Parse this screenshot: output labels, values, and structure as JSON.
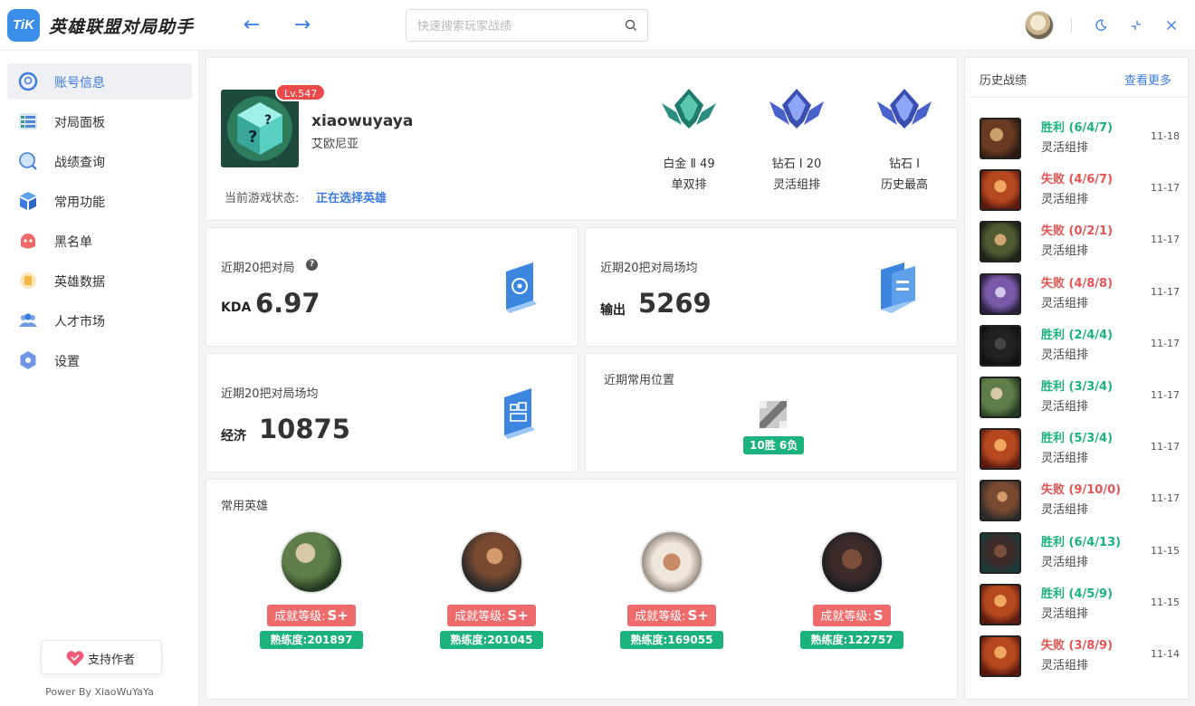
{
  "app": {
    "logo_text": "TiK",
    "title": "英雄联盟对局助手"
  },
  "header": {
    "search_placeholder": "快速搜索玩家战绩",
    "icons": [
      "back-arrow-icon",
      "forward-arrow-icon",
      "search-icon",
      "moon-icon",
      "minimize-icon",
      "close-icon"
    ]
  },
  "sidebar": {
    "items": [
      {
        "label": "账号信息",
        "icon": "account-icon",
        "active": true
      },
      {
        "label": "对局面板",
        "icon": "match-panel-icon",
        "active": false
      },
      {
        "label": "战绩查询",
        "icon": "record-search-icon",
        "active": false
      },
      {
        "label": "常用功能",
        "icon": "tools-icon",
        "active": false
      },
      {
        "label": "黑名单",
        "icon": "blacklist-icon",
        "active": false
      },
      {
        "label": "英雄数据",
        "icon": "champion-data-icon",
        "active": false
      },
      {
        "label": "人才市场",
        "icon": "talent-market-icon",
        "active": false
      },
      {
        "label": "设置",
        "icon": "settings-icon",
        "active": false
      }
    ],
    "support_label": "支持作者",
    "powered_by": "Power By XiaoWuYaYa"
  },
  "profile": {
    "level": "Lv.547",
    "name": "xiaowuyaya",
    "server": "艾欧尼亚",
    "status_label": "当前游戏状态:",
    "status_value": "正在选择英雄",
    "ranks": [
      {
        "tier": "白金 Ⅱ 49",
        "queue": "单双排",
        "color": "#1f7a6e"
      },
      {
        "tier": "钻石 Ⅰ 20",
        "queue": "灵活组排",
        "color": "#3b4fb3"
      },
      {
        "tier": "钻石 Ⅰ",
        "queue": "历史最高",
        "color": "#3b4fb3"
      }
    ]
  },
  "stats": {
    "kda": {
      "label": "近期20把对局",
      "key": "KDA",
      "value": "6.97"
    },
    "damage": {
      "label": "近期20把对局场均",
      "key": "输出",
      "value": "5269"
    },
    "gold": {
      "label": "近期20把对局场均",
      "key": "经济",
      "value": "10875"
    },
    "position": {
      "label": "近期常用位置",
      "record": "10胜 6负"
    }
  },
  "champions": {
    "title": "常用英雄",
    "achievement_prefix": "成就等级:",
    "mastery_prefix": "熟练度:",
    "items": [
      {
        "grade": "S+",
        "mastery": "201897"
      },
      {
        "grade": "S+",
        "mastery": "201045"
      },
      {
        "grade": "S+",
        "mastery": "169055"
      },
      {
        "grade": "S",
        "mastery": "122757"
      }
    ]
  },
  "history": {
    "title": "历史战绩",
    "more": "查看更多",
    "matches": [
      {
        "result": "胜利 (6/4/7)",
        "win": true,
        "mode": "灵活组排",
        "date": "11-18"
      },
      {
        "result": "失败 (4/6/7)",
        "win": false,
        "mode": "灵活组排",
        "date": "11-17"
      },
      {
        "result": "失败 (0/2/1)",
        "win": false,
        "mode": "灵活组排",
        "date": "11-17"
      },
      {
        "result": "失败 (4/8/8)",
        "win": false,
        "mode": "灵活组排",
        "date": "11-17"
      },
      {
        "result": "胜利 (2/4/4)",
        "win": true,
        "mode": "灵活组排",
        "date": "11-17"
      },
      {
        "result": "胜利 (3/3/4)",
        "win": true,
        "mode": "灵活组排",
        "date": "11-17"
      },
      {
        "result": "胜利 (5/3/4)",
        "win": true,
        "mode": "灵活组排",
        "date": "11-17"
      },
      {
        "result": "失败 (9/10/0)",
        "win": false,
        "mode": "灵活组排",
        "date": "11-17"
      },
      {
        "result": "胜利 (6/4/13)",
        "win": true,
        "mode": "灵活组排",
        "date": "11-15"
      },
      {
        "result": "胜利 (4/5/9)",
        "win": true,
        "mode": "灵活组排",
        "date": "11-15"
      },
      {
        "result": "失败 (3/8/9)",
        "win": false,
        "mode": "灵活组排",
        "date": "11-14"
      }
    ]
  },
  "colors": {
    "accent": "#3d7be0",
    "win": "#1cb27c",
    "loss": "#e45454",
    "badge_red": "#ef6b6b"
  }
}
